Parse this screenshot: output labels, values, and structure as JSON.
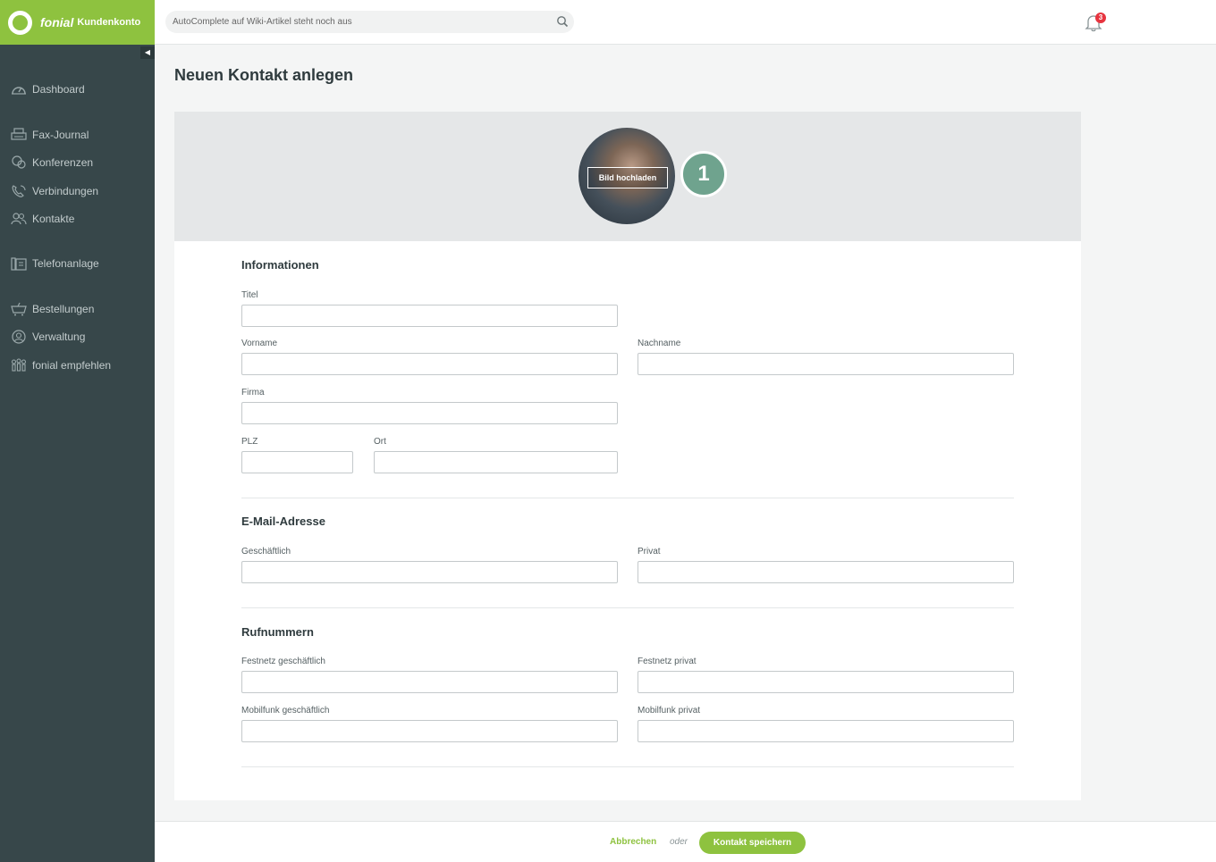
{
  "brand": {
    "name": "fonial",
    "subtitle": "Kundenkonto"
  },
  "sidebar": {
    "items": [
      {
        "label": "Dashboard",
        "icon": "dashboard-icon"
      },
      {
        "label": "Fax-Journal",
        "icon": "fax-icon"
      },
      {
        "label": "Konferenzen",
        "icon": "conference-icon"
      },
      {
        "label": "Verbindungen",
        "icon": "phone-connections-icon"
      },
      {
        "label": "Kontakte",
        "icon": "contacts-icon"
      },
      {
        "label": "Telefonanlage",
        "icon": "phone-system-icon"
      },
      {
        "label": "Bestellungen",
        "icon": "cart-icon"
      },
      {
        "label": "Verwaltung",
        "icon": "user-admin-icon"
      },
      {
        "label": "fonial empfehlen",
        "icon": "recommend-icon"
      }
    ]
  },
  "header": {
    "search_placeholder": "AutoComplete auf Wiki-Artikel steht noch aus",
    "notification_count": "3"
  },
  "page": {
    "title": "Neuen Kontakt anlegen"
  },
  "photo": {
    "upload_label": "Bild hochladen",
    "step_marker": "1"
  },
  "sections": {
    "info": {
      "title": "Informationen",
      "titel": "Titel",
      "vorname": "Vorname",
      "nachname": "Nachname",
      "firma": "Firma",
      "plz": "PLZ",
      "ort": "Ort"
    },
    "email": {
      "title": "E-Mail-Adresse",
      "business": "Geschäftlich",
      "private": "Privat"
    },
    "phone": {
      "title": "Rufnummern",
      "landline_business": "Festnetz geschäftlich",
      "landline_private": "Festnetz privat",
      "mobile_business": "Mobilfunk geschäftlich",
      "mobile_private": "Mobilfunk privat"
    }
  },
  "footer": {
    "cancel_label": "Abbrechen",
    "or_label": "oder",
    "save_label": "Kontakt speichern"
  },
  "colors": {
    "brand_green": "#8ec23f",
    "sidebar_bg": "#37474a",
    "step_marker": "#6fa38e",
    "badge_red": "#e7343f"
  }
}
